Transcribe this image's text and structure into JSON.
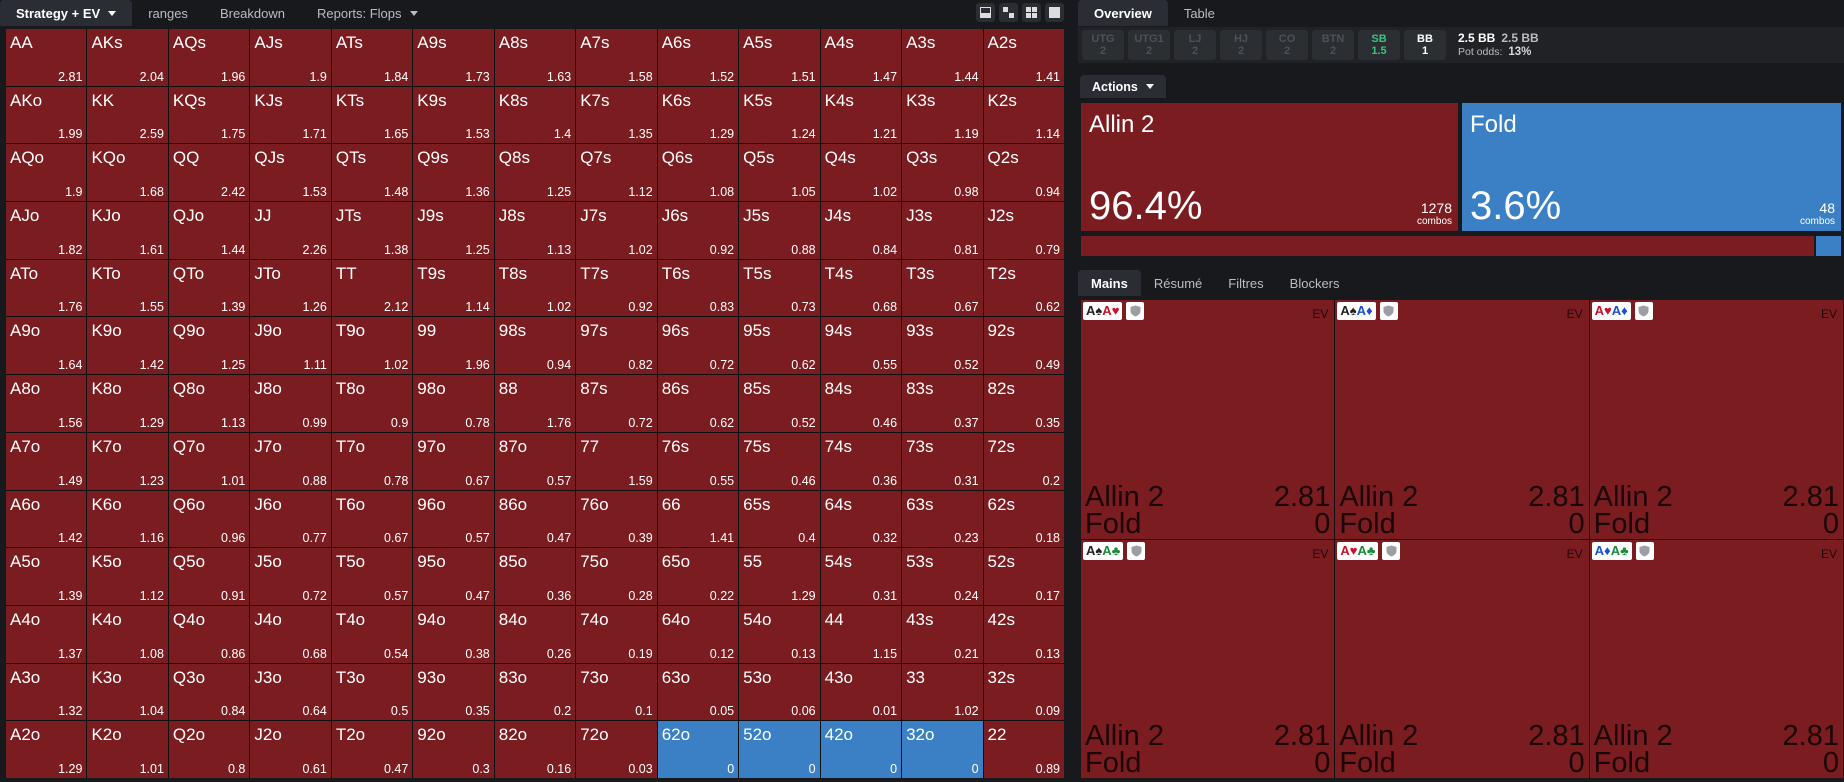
{
  "left_tabs": [
    {
      "label": "Strategy + EV",
      "dropdown": true,
      "active": true
    },
    {
      "label": "ranges",
      "dropdown": false,
      "active": false
    },
    {
      "label": "Breakdown",
      "dropdown": false,
      "active": false
    },
    {
      "label": "Reports: Flops",
      "dropdown": true,
      "active": false
    }
  ],
  "view_icons": [
    "single-pane-icon",
    "split-pane-icon",
    "grid-pane-icon",
    "full-pane-icon"
  ],
  "colors": {
    "allin": "#7a1c20",
    "fold": "#3b80c4",
    "sb": "#39c37f"
  },
  "grid": [
    [
      [
        "AA",
        "2.81",
        "a"
      ],
      [
        "AKs",
        "2.04",
        "a"
      ],
      [
        "AQs",
        "1.96",
        "a"
      ],
      [
        "AJs",
        "1.9",
        "a"
      ],
      [
        "ATs",
        "1.84",
        "a"
      ],
      [
        "A9s",
        "1.73",
        "a"
      ],
      [
        "A8s",
        "1.63",
        "a"
      ],
      [
        "A7s",
        "1.58",
        "a"
      ],
      [
        "A6s",
        "1.52",
        "a"
      ],
      [
        "A5s",
        "1.51",
        "a"
      ],
      [
        "A4s",
        "1.47",
        "a"
      ],
      [
        "A3s",
        "1.44",
        "a"
      ],
      [
        "A2s",
        "1.41",
        "a"
      ]
    ],
    [
      [
        "AKo",
        "1.99",
        "a"
      ],
      [
        "KK",
        "2.59",
        "a"
      ],
      [
        "KQs",
        "1.75",
        "a"
      ],
      [
        "KJs",
        "1.71",
        "a"
      ],
      [
        "KTs",
        "1.65",
        "a"
      ],
      [
        "K9s",
        "1.53",
        "a"
      ],
      [
        "K8s",
        "1.4",
        "a"
      ],
      [
        "K7s",
        "1.35",
        "a"
      ],
      [
        "K6s",
        "1.29",
        "a"
      ],
      [
        "K5s",
        "1.24",
        "a"
      ],
      [
        "K4s",
        "1.21",
        "a"
      ],
      [
        "K3s",
        "1.19",
        "a"
      ],
      [
        "K2s",
        "1.14",
        "a"
      ]
    ],
    [
      [
        "AQo",
        "1.9",
        "a"
      ],
      [
        "KQo",
        "1.68",
        "a"
      ],
      [
        "QQ",
        "2.42",
        "a"
      ],
      [
        "QJs",
        "1.53",
        "a"
      ],
      [
        "QTs",
        "1.48",
        "a"
      ],
      [
        "Q9s",
        "1.36",
        "a"
      ],
      [
        "Q8s",
        "1.25",
        "a"
      ],
      [
        "Q7s",
        "1.12",
        "a"
      ],
      [
        "Q6s",
        "1.08",
        "a"
      ],
      [
        "Q5s",
        "1.05",
        "a"
      ],
      [
        "Q4s",
        "1.02",
        "a"
      ],
      [
        "Q3s",
        "0.98",
        "a"
      ],
      [
        "Q2s",
        "0.94",
        "a"
      ]
    ],
    [
      [
        "AJo",
        "1.82",
        "a"
      ],
      [
        "KJo",
        "1.61",
        "a"
      ],
      [
        "QJo",
        "1.44",
        "a"
      ],
      [
        "JJ",
        "2.26",
        "a"
      ],
      [
        "JTs",
        "1.38",
        "a"
      ],
      [
        "J9s",
        "1.25",
        "a"
      ],
      [
        "J8s",
        "1.13",
        "a"
      ],
      [
        "J7s",
        "1.02",
        "a"
      ],
      [
        "J6s",
        "0.92",
        "a"
      ],
      [
        "J5s",
        "0.88",
        "a"
      ],
      [
        "J4s",
        "0.84",
        "a"
      ],
      [
        "J3s",
        "0.81",
        "a"
      ],
      [
        "J2s",
        "0.79",
        "a"
      ]
    ],
    [
      [
        "ATo",
        "1.76",
        "a"
      ],
      [
        "KTo",
        "1.55",
        "a"
      ],
      [
        "QTo",
        "1.39",
        "a"
      ],
      [
        "JTo",
        "1.26",
        "a"
      ],
      [
        "TT",
        "2.12",
        "a"
      ],
      [
        "T9s",
        "1.14",
        "a"
      ],
      [
        "T8s",
        "1.02",
        "a"
      ],
      [
        "T7s",
        "0.92",
        "a"
      ],
      [
        "T6s",
        "0.83",
        "a"
      ],
      [
        "T5s",
        "0.73",
        "a"
      ],
      [
        "T4s",
        "0.68",
        "a"
      ],
      [
        "T3s",
        "0.67",
        "a"
      ],
      [
        "T2s",
        "0.62",
        "a"
      ]
    ],
    [
      [
        "A9o",
        "1.64",
        "a"
      ],
      [
        "K9o",
        "1.42",
        "a"
      ],
      [
        "Q9o",
        "1.25",
        "a"
      ],
      [
        "J9o",
        "1.11",
        "a"
      ],
      [
        "T9o",
        "1.02",
        "a"
      ],
      [
        "99",
        "1.96",
        "a"
      ],
      [
        "98s",
        "0.94",
        "a"
      ],
      [
        "97s",
        "0.82",
        "a"
      ],
      [
        "96s",
        "0.72",
        "a"
      ],
      [
        "95s",
        "0.62",
        "a"
      ],
      [
        "94s",
        "0.55",
        "a"
      ],
      [
        "93s",
        "0.52",
        "a"
      ],
      [
        "92s",
        "0.49",
        "a"
      ]
    ],
    [
      [
        "A8o",
        "1.56",
        "a"
      ],
      [
        "K8o",
        "1.29",
        "a"
      ],
      [
        "Q8o",
        "1.13",
        "a"
      ],
      [
        "J8o",
        "0.99",
        "a"
      ],
      [
        "T8o",
        "0.9",
        "a"
      ],
      [
        "98o",
        "0.78",
        "a"
      ],
      [
        "88",
        "1.76",
        "a"
      ],
      [
        "87s",
        "0.72",
        "a"
      ],
      [
        "86s",
        "0.62",
        "a"
      ],
      [
        "85s",
        "0.52",
        "a"
      ],
      [
        "84s",
        "0.46",
        "a"
      ],
      [
        "83s",
        "0.37",
        "a"
      ],
      [
        "82s",
        "0.35",
        "a"
      ]
    ],
    [
      [
        "A7o",
        "1.49",
        "a"
      ],
      [
        "K7o",
        "1.23",
        "a"
      ],
      [
        "Q7o",
        "1.01",
        "a"
      ],
      [
        "J7o",
        "0.88",
        "a"
      ],
      [
        "T7o",
        "0.78",
        "a"
      ],
      [
        "97o",
        "0.67",
        "a"
      ],
      [
        "87o",
        "0.57",
        "a"
      ],
      [
        "77",
        "1.59",
        "a"
      ],
      [
        "76s",
        "0.55",
        "a"
      ],
      [
        "75s",
        "0.46",
        "a"
      ],
      [
        "74s",
        "0.36",
        "a"
      ],
      [
        "73s",
        "0.31",
        "a"
      ],
      [
        "72s",
        "0.2",
        "a"
      ]
    ],
    [
      [
        "A6o",
        "1.42",
        "a"
      ],
      [
        "K6o",
        "1.16",
        "a"
      ],
      [
        "Q6o",
        "0.96",
        "a"
      ],
      [
        "J6o",
        "0.77",
        "a"
      ],
      [
        "T6o",
        "0.67",
        "a"
      ],
      [
        "96o",
        "0.57",
        "a"
      ],
      [
        "86o",
        "0.47",
        "a"
      ],
      [
        "76o",
        "0.39",
        "a"
      ],
      [
        "66",
        "1.41",
        "a"
      ],
      [
        "65s",
        "0.4",
        "a"
      ],
      [
        "64s",
        "0.32",
        "a"
      ],
      [
        "63s",
        "0.23",
        "a"
      ],
      [
        "62s",
        "0.18",
        "a"
      ]
    ],
    [
      [
        "A5o",
        "1.39",
        "a"
      ],
      [
        "K5o",
        "1.12",
        "a"
      ],
      [
        "Q5o",
        "0.91",
        "a"
      ],
      [
        "J5o",
        "0.72",
        "a"
      ],
      [
        "T5o",
        "0.57",
        "a"
      ],
      [
        "95o",
        "0.47",
        "a"
      ],
      [
        "85o",
        "0.36",
        "a"
      ],
      [
        "75o",
        "0.28",
        "a"
      ],
      [
        "65o",
        "0.22",
        "a"
      ],
      [
        "55",
        "1.29",
        "a"
      ],
      [
        "54s",
        "0.31",
        "a"
      ],
      [
        "53s",
        "0.24",
        "a"
      ],
      [
        "52s",
        "0.17",
        "a"
      ]
    ],
    [
      [
        "A4o",
        "1.37",
        "a"
      ],
      [
        "K4o",
        "1.08",
        "a"
      ],
      [
        "Q4o",
        "0.86",
        "a"
      ],
      [
        "J4o",
        "0.68",
        "a"
      ],
      [
        "T4o",
        "0.54",
        "a"
      ],
      [
        "94o",
        "0.38",
        "a"
      ],
      [
        "84o",
        "0.26",
        "a"
      ],
      [
        "74o",
        "0.19",
        "a"
      ],
      [
        "64o",
        "0.12",
        "a"
      ],
      [
        "54o",
        "0.13",
        "a"
      ],
      [
        "44",
        "1.15",
        "a"
      ],
      [
        "43s",
        "0.21",
        "a"
      ],
      [
        "42s",
        "0.13",
        "a"
      ]
    ],
    [
      [
        "A3o",
        "1.32",
        "a"
      ],
      [
        "K3o",
        "1.04",
        "a"
      ],
      [
        "Q3o",
        "0.84",
        "a"
      ],
      [
        "J3o",
        "0.64",
        "a"
      ],
      [
        "T3o",
        "0.5",
        "a"
      ],
      [
        "93o",
        "0.35",
        "a"
      ],
      [
        "83o",
        "0.2",
        "a"
      ],
      [
        "73o",
        "0.1",
        "a"
      ],
      [
        "63o",
        "0.05",
        "a"
      ],
      [
        "53o",
        "0.06",
        "a"
      ],
      [
        "43o",
        "0.01",
        "a"
      ],
      [
        "33",
        "1.02",
        "a"
      ],
      [
        "32s",
        "0.09",
        "a"
      ]
    ],
    [
      [
        "A2o",
        "1.29",
        "a"
      ],
      [
        "K2o",
        "1.01",
        "a"
      ],
      [
        "Q2o",
        "0.8",
        "a"
      ],
      [
        "J2o",
        "0.61",
        "a"
      ],
      [
        "T2o",
        "0.47",
        "a"
      ],
      [
        "92o",
        "0.3",
        "a"
      ],
      [
        "82o",
        "0.16",
        "a"
      ],
      [
        "72o",
        "0.03",
        "a"
      ],
      [
        "62o",
        "0",
        "f"
      ],
      [
        "52o",
        "0",
        "f"
      ],
      [
        "42o",
        "0",
        "f"
      ],
      [
        "32o",
        "0",
        "f"
      ],
      [
        "22",
        "0.89",
        "a"
      ]
    ]
  ],
  "right_tabs": [
    {
      "label": "Overview",
      "active": true
    },
    {
      "label": "Table",
      "active": false
    }
  ],
  "seats": [
    {
      "name": "UTG",
      "stack": "2",
      "state": "inactive"
    },
    {
      "name": "UTG1",
      "stack": "2",
      "state": "inactive"
    },
    {
      "name": "LJ",
      "stack": "2",
      "state": "inactive"
    },
    {
      "name": "HJ",
      "stack": "2",
      "state": "inactive"
    },
    {
      "name": "CO",
      "stack": "2",
      "state": "inactive"
    },
    {
      "name": "BTN",
      "stack": "2",
      "state": "inactive"
    },
    {
      "name": "SB",
      "stack": "1.5",
      "state": "sb"
    },
    {
      "name": "BB",
      "stack": "1",
      "state": "bb"
    }
  ],
  "pot": {
    "main": "2.5 BB",
    "secondary": "2.5 BB",
    "odds_label": "Pot odds:",
    "odds_value": "13%"
  },
  "actions_button": "Actions",
  "actions": [
    {
      "name": "Allin 2",
      "pct": "96.4%",
      "combos": "1278",
      "combos_label": "combos",
      "share": 96.4
    },
    {
      "name": "Fold",
      "pct": "3.6%",
      "combos": "48",
      "combos_label": "combos",
      "share": 3.6
    }
  ],
  "bottom_tabs": [
    {
      "label": "Mains",
      "active": true
    },
    {
      "label": "Résumé",
      "active": false
    },
    {
      "label": "Filtres",
      "active": false
    },
    {
      "label": "Blockers",
      "active": false
    }
  ],
  "combos": [
    {
      "c1r": "A",
      "c1s": "♠",
      "c1c": "#222",
      "c2r": "A",
      "c2s": "♥",
      "c2c": "#c8102e",
      "ev_label": "EV",
      "rows": [
        {
          "a": "Allin 2",
          "v": "2.81"
        },
        {
          "a": "Fold",
          "v": "0"
        }
      ]
    },
    {
      "c1r": "A",
      "c1s": "♠",
      "c1c": "#222",
      "c2r": "A",
      "c2s": "♦",
      "c2c": "#1b4fd0",
      "ev_label": "EV",
      "rows": [
        {
          "a": "Allin 2",
          "v": "2.81"
        },
        {
          "a": "Fold",
          "v": "0"
        }
      ]
    },
    {
      "c1r": "A",
      "c1s": "♥",
      "c1c": "#c8102e",
      "c2r": "A",
      "c2s": "♦",
      "c2c": "#1b4fd0",
      "ev_label": "EV",
      "rows": [
        {
          "a": "Allin 2",
          "v": "2.81"
        },
        {
          "a": "Fold",
          "v": "0"
        }
      ]
    },
    {
      "c1r": "A",
      "c1s": "♠",
      "c1c": "#222",
      "c2r": "A",
      "c2s": "♣",
      "c2c": "#1b8a3a",
      "ev_label": "EV",
      "rows": [
        {
          "a": "Allin 2",
          "v": "2.81"
        },
        {
          "a": "Fold",
          "v": "0"
        }
      ]
    },
    {
      "c1r": "A",
      "c1s": "♥",
      "c1c": "#c8102e",
      "c2r": "A",
      "c2s": "♣",
      "c2c": "#1b8a3a",
      "ev_label": "EV",
      "rows": [
        {
          "a": "Allin 2",
          "v": "2.81"
        },
        {
          "a": "Fold",
          "v": "0"
        }
      ]
    },
    {
      "c1r": "A",
      "c1s": "♦",
      "c1c": "#1b4fd0",
      "c2r": "A",
      "c2s": "♣",
      "c2c": "#1b8a3a",
      "ev_label": "EV",
      "rows": [
        {
          "a": "Allin 2",
          "v": "2.81"
        },
        {
          "a": "Fold",
          "v": "0"
        }
      ]
    }
  ]
}
